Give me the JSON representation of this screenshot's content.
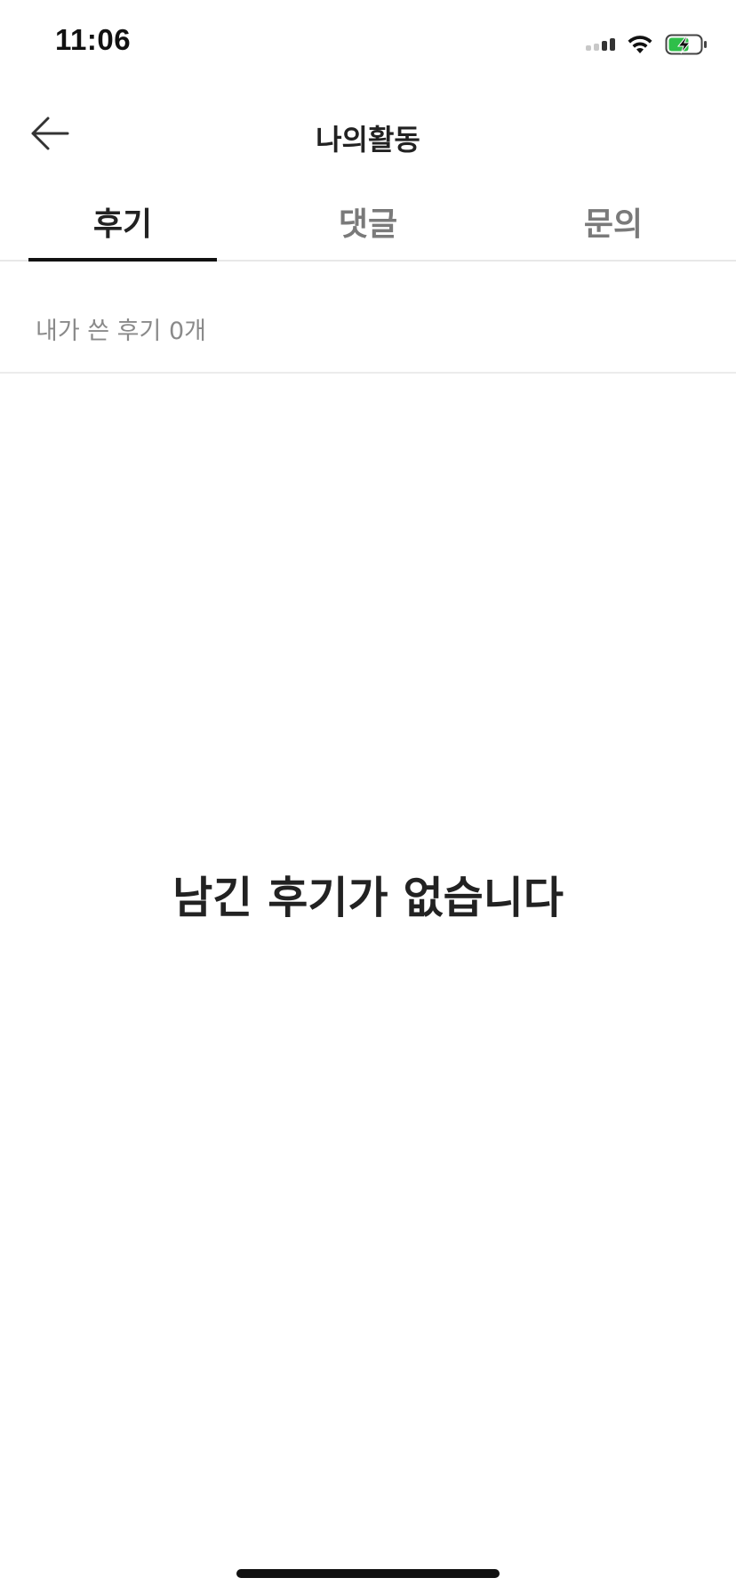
{
  "status_bar": {
    "time": "11:06",
    "icons": [
      "signal-icon",
      "wifi-icon",
      "battery-charging-icon"
    ],
    "battery_color": "#2fbf4a"
  },
  "nav": {
    "title": "나의활동",
    "back_icon": "arrow-left-icon"
  },
  "tabs": [
    {
      "label": "후기",
      "active": true
    },
    {
      "label": "댓글",
      "active": false
    },
    {
      "label": "문의",
      "active": false
    }
  ],
  "review_list": {
    "count_label": "내가 쓴 후기 0개",
    "empty_message": "남긴 후기가 없습니다"
  }
}
